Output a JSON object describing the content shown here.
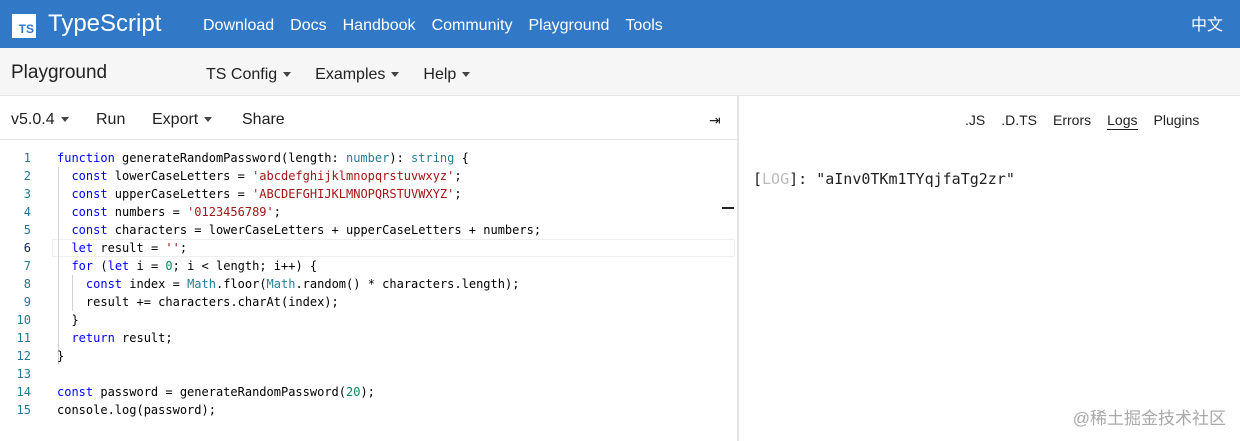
{
  "header": {
    "logo_mark": "TS",
    "brand": "TypeScript",
    "nav": [
      "Download",
      "Docs",
      "Handbook",
      "Community",
      "Playground",
      "Tools"
    ],
    "lang": "中文",
    "bg_color": "#3178c6"
  },
  "subbar": {
    "title": "Playground",
    "menus": [
      "TS Config",
      "Examples",
      "Help"
    ]
  },
  "toolbar": {
    "version": "v5.0.4",
    "run": "Run",
    "export": "Export",
    "share": "Share",
    "collapse_icon": "⇥"
  },
  "editor": {
    "line_numbers": [
      "1",
      "2",
      "3",
      "4",
      "5",
      "6",
      "7",
      "8",
      "9",
      "10",
      "11",
      "12",
      "13",
      "14",
      "15"
    ],
    "active_line": 6
  },
  "output": {
    "tabs": [
      ".JS",
      ".D.TS",
      "Errors",
      "Logs",
      "Plugins"
    ],
    "active_tab": "Logs",
    "log_tag": "LOG",
    "log_value": "\"aInv0TKm1TYqjfaTg2zr\""
  },
  "watermark": "@稀土掘金技术社区"
}
